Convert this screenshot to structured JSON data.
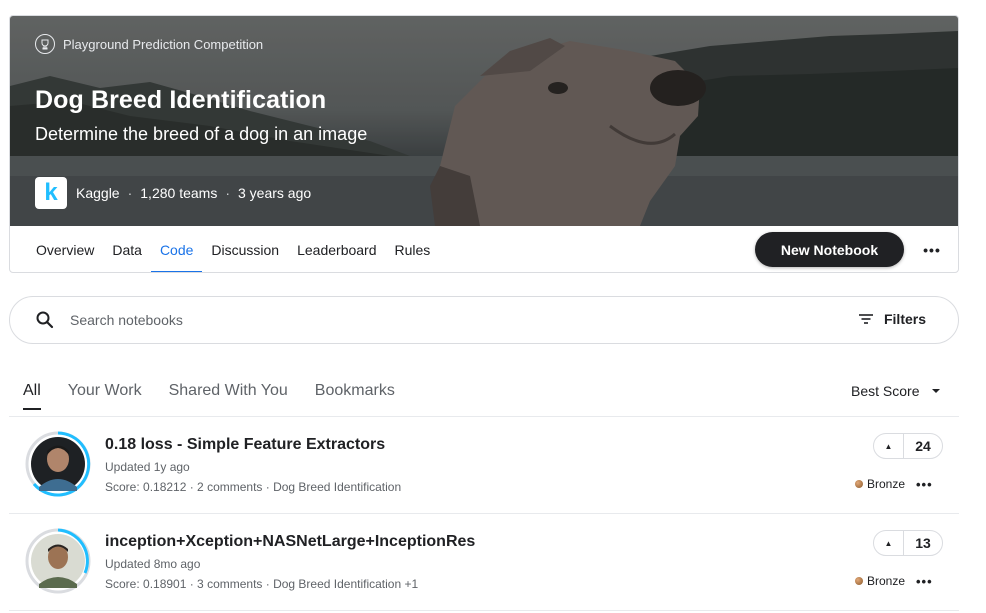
{
  "competition": {
    "type": "Playground Prediction Competition",
    "title": "Dog Breed Identification",
    "subtitle": "Determine the breed of a dog in an image",
    "host_logo_letter": "k",
    "host": "Kaggle",
    "teams": "1,280 teams",
    "age": "3 years ago"
  },
  "tabs": [
    {
      "label": "Overview"
    },
    {
      "label": "Data"
    },
    {
      "label": "Code"
    },
    {
      "label": "Discussion"
    },
    {
      "label": "Leaderboard"
    },
    {
      "label": "Rules"
    }
  ],
  "active_tab": "Code",
  "new_notebook_label": "New Notebook",
  "search": {
    "placeholder": "Search notebooks",
    "filters_label": "Filters"
  },
  "subtabs": [
    {
      "label": "All"
    },
    {
      "label": "Your Work"
    },
    {
      "label": "Shared With You"
    },
    {
      "label": "Bookmarks"
    }
  ],
  "sort_label": "Best Score",
  "notebooks": [
    {
      "title": "0.18 loss - Simple Feature Extractors",
      "updated": "Updated 1y ago",
      "meta": "Score: 0.18212 · 2 comments · Dog Breed Identification",
      "votes": "24",
      "medal": "Bronze"
    },
    {
      "title": "inception+Xception+NASNetLarge+InceptionRes",
      "updated": "Updated 8mo ago",
      "meta": "Score: 0.18901 · 3 comments · Dog Breed Identification +1",
      "votes": "13",
      "medal": "Bronze"
    }
  ],
  "colors": {
    "accent": "#1a73e8",
    "button_dark": "#202124",
    "kaggle_blue": "#20beff",
    "progress_ring": "#20beff"
  },
  "icons": [
    "trophy-icon",
    "search-icon",
    "filter-icon",
    "caret-down-icon",
    "upvote-icon",
    "more-icon",
    "bronze-medal-icon"
  ]
}
